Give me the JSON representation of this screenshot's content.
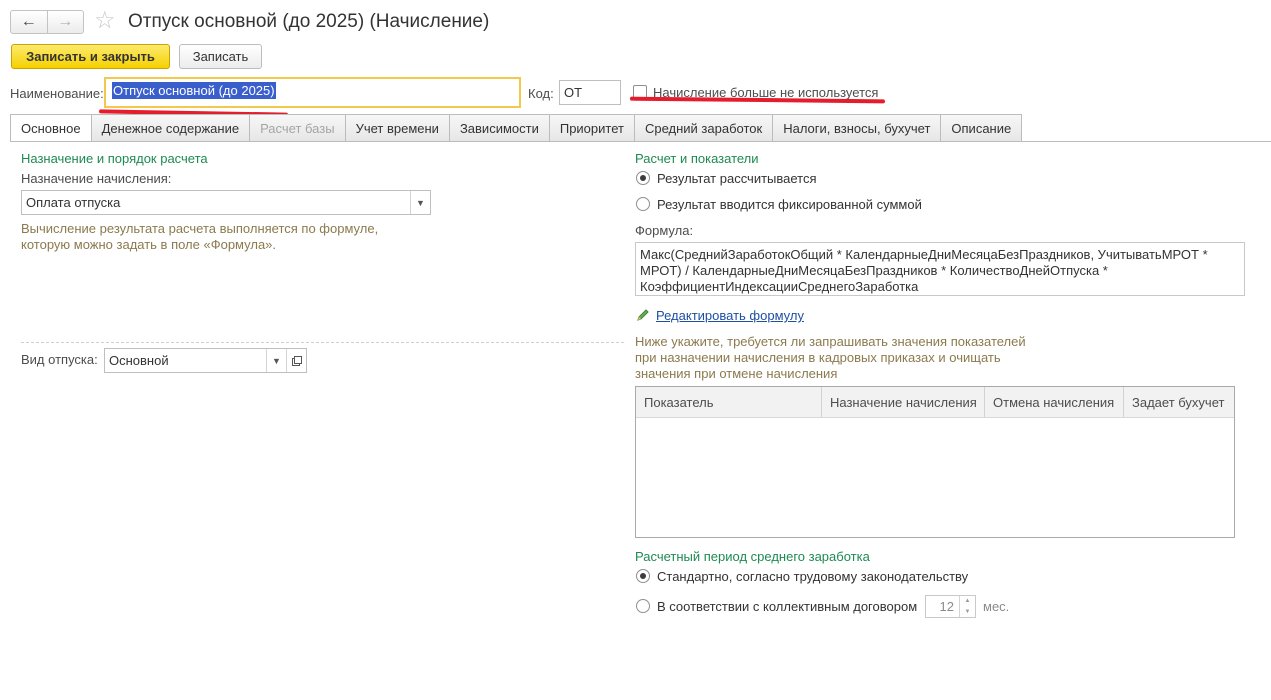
{
  "header": {
    "back_icon": "arrow-left-icon",
    "forward_icon": "arrow-right-icon",
    "favorite_icon": "star-icon",
    "title": "Отпуск основной (до 2025) (Начисление)"
  },
  "toolbar": {
    "save_close_label": "Записать и закрыть",
    "save_label": "Записать"
  },
  "form": {
    "name_label": "Наименование:",
    "name_value": "Отпуск основной (до 2025)",
    "code_label": "Код:",
    "code_value": "ОТ",
    "not_used_label": "Начисление больше не используется",
    "not_used_checked": false
  },
  "tabs": [
    {
      "label": "Основное",
      "active": true,
      "enabled": true
    },
    {
      "label": "Денежное содержание",
      "active": false,
      "enabled": true
    },
    {
      "label": "Расчет базы",
      "active": false,
      "enabled": false
    },
    {
      "label": "Учет времени",
      "active": false,
      "enabled": true
    },
    {
      "label": "Зависимости",
      "active": false,
      "enabled": true
    },
    {
      "label": "Приоритет",
      "active": false,
      "enabled": true
    },
    {
      "label": "Средний заработок",
      "active": false,
      "enabled": true
    },
    {
      "label": "Налоги, взносы, бухучет",
      "active": false,
      "enabled": true
    },
    {
      "label": "Описание",
      "active": false,
      "enabled": true
    }
  ],
  "left": {
    "section_title": "Назначение и порядок расчета",
    "purpose_label": "Назначение начисления:",
    "purpose_value": "Оплата отпуска",
    "hint_line1": "Вычисление результата расчета выполняется по формуле,",
    "hint_line2": "которую можно задать в поле «Формула».",
    "vacation_type_label": "Вид отпуска:",
    "vacation_type_value": "Основной"
  },
  "right": {
    "section_title": "Расчет и показатели",
    "radio_calc_label": "Результат рассчитывается",
    "radio_fixed_label": "Результат вводится фиксированной суммой",
    "result_mode": "calc",
    "formula_label": "Формула:",
    "formula_line1": "Макс(СреднийЗаработокОбщий * КалендарныеДниМесяцаБезПраздников, УчитыватьМРОТ *",
    "formula_line2": "МРОТ) / КалендарныеДниМесяцаБезПраздников * КоличествоДнейОтпуска *",
    "formula_line3": "КоэффициентИндексацииСреднегоЗаработка",
    "edit_formula_label": "Редактировать формулу",
    "hint_line1": "Ниже укажите, требуется ли запрашивать значения показателей",
    "hint_line2": "при назначении начисления в кадровых приказах и очищать",
    "hint_line3": "значения при отмене начисления",
    "table_columns": [
      "Показатель",
      "Назначение начисления",
      "Отмена начисления",
      "Задает бухучет"
    ],
    "period_title": "Расчетный период среднего заработка",
    "period_standard_label": "Стандартно, согласно трудовому законодательству",
    "period_collective_label": "В соответствии с коллективным договором",
    "period_mode": "standard",
    "months_value": "12",
    "months_unit": "мес."
  },
  "colors": {
    "accent_yellow": "#f5d100",
    "section_green": "#1e8a52",
    "hint_brown": "#8c7a4e",
    "link_blue": "#1e4fa3",
    "annotation_red": "#e41c2c"
  }
}
